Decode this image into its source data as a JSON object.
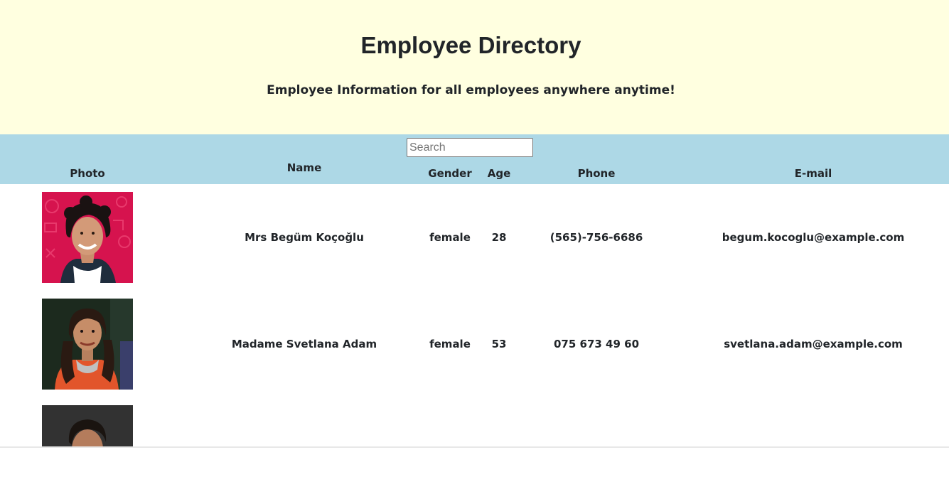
{
  "header": {
    "title": "Employee Directory",
    "subtitle": "Employee Information for all employees anywhere anytime!"
  },
  "search": {
    "placeholder": "Search",
    "value": ""
  },
  "columns": {
    "photo": "Photo",
    "name": "Name",
    "gender": "Gender",
    "age": "Age",
    "phone": "Phone",
    "email": "E-mail"
  },
  "employees": [
    {
      "name": "Mrs Begüm Koçoğlu",
      "gender": "female",
      "age": "28",
      "phone": "(565)-756-6686",
      "email": "begum.kocoglu@example.com"
    },
    {
      "name": "Madame Svetlana Adam",
      "gender": "female",
      "age": "53",
      "phone": "075 673 49 60",
      "email": "svetlana.adam@example.com"
    },
    {
      "name": "",
      "gender": "",
      "age": "",
      "phone": "",
      "email": ""
    }
  ],
  "colors": {
    "header_bg": "#ffffe0",
    "table_header_bg": "#add8e6",
    "text": "#212529"
  }
}
